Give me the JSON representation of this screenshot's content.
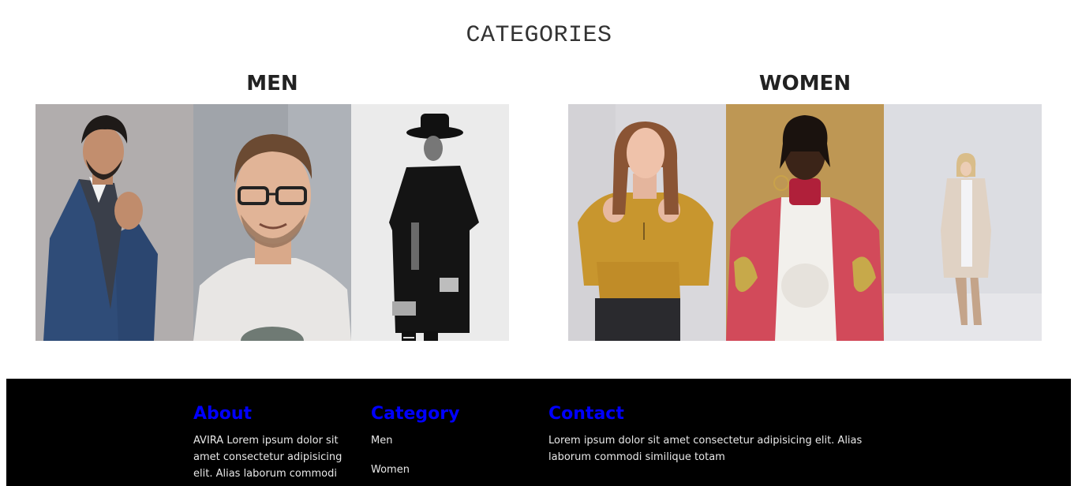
{
  "categories_section": {
    "title": "CATEGORIES",
    "men": {
      "heading": "MEN",
      "photos": [
        "man-in-blue-blazer-photo",
        "man-with-glasses-photo",
        "man-in-black-hat-coat-photo"
      ]
    },
    "women": {
      "heading": "WOMEN",
      "photos": [
        "woman-in-mustard-top-photo",
        "woman-in-red-jacket-photo",
        "woman-in-beige-coat-photo"
      ]
    }
  },
  "footer": {
    "about": {
      "heading": "About",
      "text": "AVIRA Lorem ipsum dolor sit amet consectetur adipisicing elit. Alias laborum commodi"
    },
    "category": {
      "heading": "Category",
      "links": [
        "Men",
        "Women"
      ]
    },
    "contact": {
      "heading": "Contact",
      "text": "Lorem ipsum dolor sit amet consectetur adipisicing elit. Alias laborum commodi similique totam"
    }
  },
  "colors": {
    "footer_bg": "#000000",
    "footer_heading": "#0000ff",
    "footer_text": "#e8e8e8",
    "title_text": "#333333"
  }
}
